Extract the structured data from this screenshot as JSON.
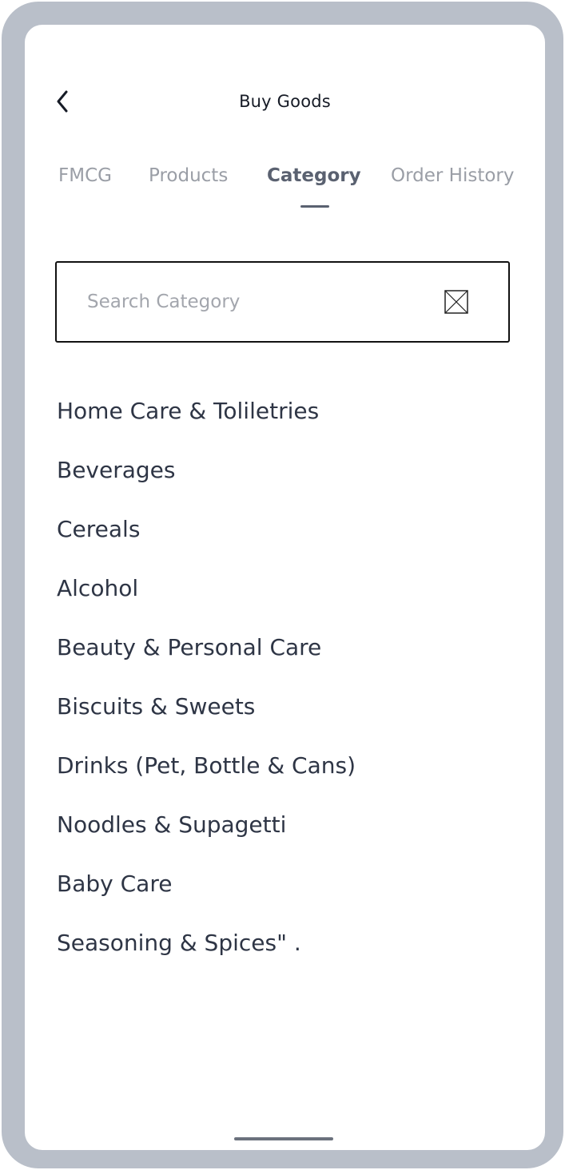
{
  "header": {
    "title": "Buy Goods",
    "back_icon": "chevron-left-icon"
  },
  "tabs": [
    {
      "label": "FMCG",
      "active": false
    },
    {
      "label": "Products",
      "active": false
    },
    {
      "label": "Category",
      "active": true
    },
    {
      "label": "Order History",
      "active": false
    }
  ],
  "search": {
    "placeholder": "Search Category",
    "value": "",
    "clear_icon": "close-box-icon"
  },
  "categories": [
    "Home Care & Toliletries",
    "Beverages",
    "Cereals",
    "Alcohol",
    "Beauty & Personal Care",
    "Biscuits & Sweets",
    "Drinks (Pet, Bottle & Cans)",
    "Noodles & Supagetti",
    "Baby Care",
    "Seasoning & Spices\" ."
  ],
  "colors": {
    "frame": "#b9bfc9",
    "active_tab": "#5a6170",
    "inactive_tab": "#9a9ea6",
    "list_text": "#2e3545"
  }
}
